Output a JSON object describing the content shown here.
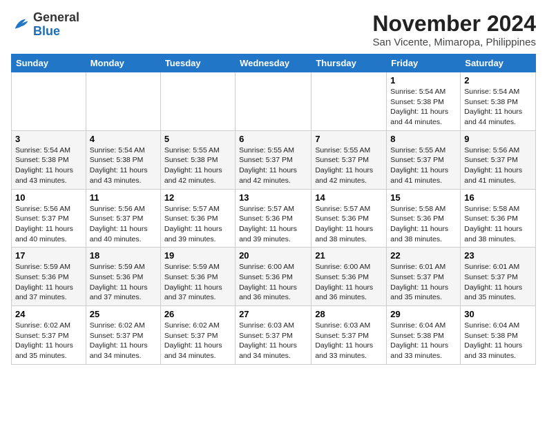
{
  "logo": {
    "text_general": "General",
    "text_blue": "Blue"
  },
  "header": {
    "month_year": "November 2024",
    "location": "San Vicente, Mimaropa, Philippines"
  },
  "weekdays": [
    "Sunday",
    "Monday",
    "Tuesday",
    "Wednesday",
    "Thursday",
    "Friday",
    "Saturday"
  ],
  "weeks": [
    [
      {
        "day": "",
        "info": ""
      },
      {
        "day": "",
        "info": ""
      },
      {
        "day": "",
        "info": ""
      },
      {
        "day": "",
        "info": ""
      },
      {
        "day": "",
        "info": ""
      },
      {
        "day": "1",
        "info": "Sunrise: 5:54 AM\nSunset: 5:38 PM\nDaylight: 11 hours and 44 minutes."
      },
      {
        "day": "2",
        "info": "Sunrise: 5:54 AM\nSunset: 5:38 PM\nDaylight: 11 hours and 44 minutes."
      }
    ],
    [
      {
        "day": "3",
        "info": "Sunrise: 5:54 AM\nSunset: 5:38 PM\nDaylight: 11 hours and 43 minutes."
      },
      {
        "day": "4",
        "info": "Sunrise: 5:54 AM\nSunset: 5:38 PM\nDaylight: 11 hours and 43 minutes."
      },
      {
        "day": "5",
        "info": "Sunrise: 5:55 AM\nSunset: 5:38 PM\nDaylight: 11 hours and 42 minutes."
      },
      {
        "day": "6",
        "info": "Sunrise: 5:55 AM\nSunset: 5:37 PM\nDaylight: 11 hours and 42 minutes."
      },
      {
        "day": "7",
        "info": "Sunrise: 5:55 AM\nSunset: 5:37 PM\nDaylight: 11 hours and 42 minutes."
      },
      {
        "day": "8",
        "info": "Sunrise: 5:55 AM\nSunset: 5:37 PM\nDaylight: 11 hours and 41 minutes."
      },
      {
        "day": "9",
        "info": "Sunrise: 5:56 AM\nSunset: 5:37 PM\nDaylight: 11 hours and 41 minutes."
      }
    ],
    [
      {
        "day": "10",
        "info": "Sunrise: 5:56 AM\nSunset: 5:37 PM\nDaylight: 11 hours and 40 minutes."
      },
      {
        "day": "11",
        "info": "Sunrise: 5:56 AM\nSunset: 5:37 PM\nDaylight: 11 hours and 40 minutes."
      },
      {
        "day": "12",
        "info": "Sunrise: 5:57 AM\nSunset: 5:36 PM\nDaylight: 11 hours and 39 minutes."
      },
      {
        "day": "13",
        "info": "Sunrise: 5:57 AM\nSunset: 5:36 PM\nDaylight: 11 hours and 39 minutes."
      },
      {
        "day": "14",
        "info": "Sunrise: 5:57 AM\nSunset: 5:36 PM\nDaylight: 11 hours and 38 minutes."
      },
      {
        "day": "15",
        "info": "Sunrise: 5:58 AM\nSunset: 5:36 PM\nDaylight: 11 hours and 38 minutes."
      },
      {
        "day": "16",
        "info": "Sunrise: 5:58 AM\nSunset: 5:36 PM\nDaylight: 11 hours and 38 minutes."
      }
    ],
    [
      {
        "day": "17",
        "info": "Sunrise: 5:59 AM\nSunset: 5:36 PM\nDaylight: 11 hours and 37 minutes."
      },
      {
        "day": "18",
        "info": "Sunrise: 5:59 AM\nSunset: 5:36 PM\nDaylight: 11 hours and 37 minutes."
      },
      {
        "day": "19",
        "info": "Sunrise: 5:59 AM\nSunset: 5:36 PM\nDaylight: 11 hours and 37 minutes."
      },
      {
        "day": "20",
        "info": "Sunrise: 6:00 AM\nSunset: 5:36 PM\nDaylight: 11 hours and 36 minutes."
      },
      {
        "day": "21",
        "info": "Sunrise: 6:00 AM\nSunset: 5:36 PM\nDaylight: 11 hours and 36 minutes."
      },
      {
        "day": "22",
        "info": "Sunrise: 6:01 AM\nSunset: 5:37 PM\nDaylight: 11 hours and 35 minutes."
      },
      {
        "day": "23",
        "info": "Sunrise: 6:01 AM\nSunset: 5:37 PM\nDaylight: 11 hours and 35 minutes."
      }
    ],
    [
      {
        "day": "24",
        "info": "Sunrise: 6:02 AM\nSunset: 5:37 PM\nDaylight: 11 hours and 35 minutes."
      },
      {
        "day": "25",
        "info": "Sunrise: 6:02 AM\nSunset: 5:37 PM\nDaylight: 11 hours and 34 minutes."
      },
      {
        "day": "26",
        "info": "Sunrise: 6:02 AM\nSunset: 5:37 PM\nDaylight: 11 hours and 34 minutes."
      },
      {
        "day": "27",
        "info": "Sunrise: 6:03 AM\nSunset: 5:37 PM\nDaylight: 11 hours and 34 minutes."
      },
      {
        "day": "28",
        "info": "Sunrise: 6:03 AM\nSunset: 5:37 PM\nDaylight: 11 hours and 33 minutes."
      },
      {
        "day": "29",
        "info": "Sunrise: 6:04 AM\nSunset: 5:38 PM\nDaylight: 11 hours and 33 minutes."
      },
      {
        "day": "30",
        "info": "Sunrise: 6:04 AM\nSunset: 5:38 PM\nDaylight: 11 hours and 33 minutes."
      }
    ]
  ]
}
